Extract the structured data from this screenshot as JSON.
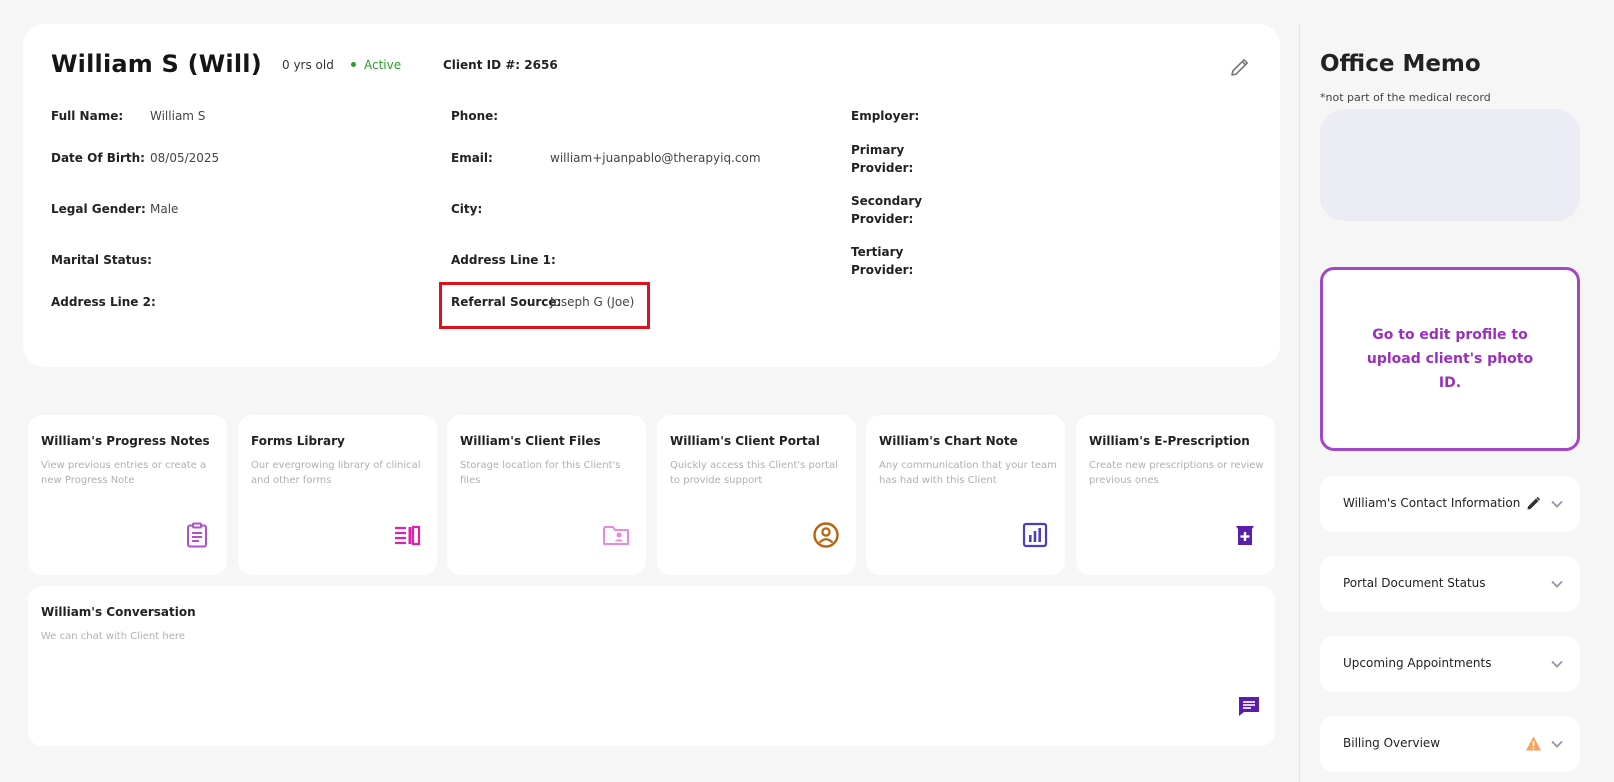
{
  "client": {
    "name": "William S (Will)",
    "age": "0 yrs old",
    "status": "Active",
    "client_id": "Client ID #: 2656"
  },
  "fields": {
    "full_name": {
      "label": "Full Name:",
      "value": "William S"
    },
    "dob": {
      "label": "Date Of Birth:",
      "value": "08/05/2025"
    },
    "legal_gender": {
      "label": "Legal Gender:",
      "value": "Male"
    },
    "marital_status": {
      "label": "Marital Status:",
      "value": ""
    },
    "address_line_2": {
      "label": "Address Line 2:",
      "value": ""
    },
    "phone": {
      "label": "Phone:",
      "value": ""
    },
    "email": {
      "label": "Email:",
      "value": "william+juanpablo@therapyiq.com"
    },
    "city": {
      "label": "City:",
      "value": ""
    },
    "address_line_1": {
      "label": "Address Line 1:",
      "value": ""
    },
    "referral_source": {
      "label": "Referral Source:",
      "value": "Joseph G (Joe)"
    },
    "employer": {
      "label": "Employer:",
      "value": ""
    },
    "primary_provider": {
      "label": "Primary Provider:",
      "value": ""
    },
    "secondary_provider": {
      "label": "Secondary Provider:",
      "value": ""
    },
    "tertiary_provider": {
      "label": "Tertiary Provider:",
      "value": ""
    }
  },
  "tiles": [
    {
      "title": "William's Progress Notes",
      "desc": "View previous entries or create a new Progress Note",
      "icon": "clipboard-icon",
      "color": "#b04fd0"
    },
    {
      "title": "Forms Library",
      "desc": "Our evergrowing library of clinical and other forms",
      "icon": "library-icon",
      "color": "#e21fa8"
    },
    {
      "title": "William's Client Files",
      "desc": "Storage location for this Client's files",
      "icon": "folder-user-icon",
      "color": "#e48ae0"
    },
    {
      "title": "William's Client Portal",
      "desc": "Quickly access this Client's portal to provide support",
      "icon": "user-circle-icon",
      "color": "#b8640f"
    },
    {
      "title": "William's Chart Note",
      "desc": "Any communication that your team has had with this Client",
      "icon": "bar-chart-icon",
      "color": "#4a3fc2"
    },
    {
      "title": "William's E-Prescription",
      "desc": "Create new prescriptions or review previous ones",
      "icon": "prescription-icon",
      "color": "#5a1fa8"
    }
  ],
  "conversation": {
    "title": "William's Conversation",
    "desc": "We can chat with Client here",
    "icon": "chat-icon",
    "color": "#5a1fa8"
  },
  "office_memo": {
    "title": "Office Memo",
    "note": "*not part of the medical record",
    "text": ""
  },
  "photo_id": {
    "message": "Go to edit profile to upload client's photo ID."
  },
  "accordions": [
    {
      "label": "William's Contact Information",
      "extra_icon": "pencil-icon"
    },
    {
      "label": "Portal Document Status",
      "extra_icon": ""
    },
    {
      "label": "Upcoming Appointments",
      "extra_icon": ""
    },
    {
      "label": "Billing Overview",
      "extra_icon": "warning-icon"
    }
  ],
  "colors": {
    "accent_purple": "#a347c9",
    "active_green": "#2a9d2a",
    "highlight_red": "#e0111b",
    "warning_orange": "#f5a25d"
  }
}
